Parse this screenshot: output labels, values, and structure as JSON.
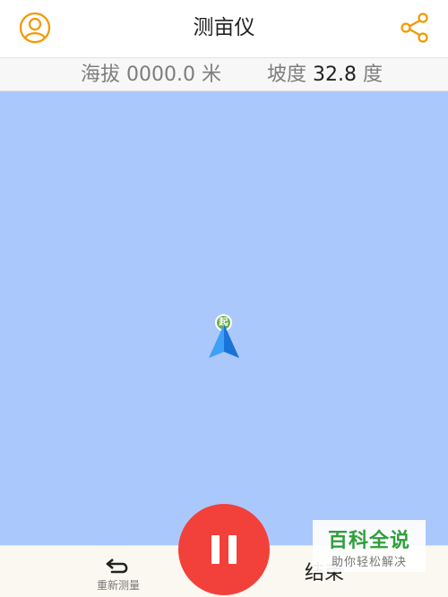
{
  "header": {
    "title": "测亩仪",
    "user_icon": "user-circle-icon",
    "share_icon": "share-icon",
    "accent_color": "#f39800"
  },
  "info_bar": {
    "altitude_label": "海拔",
    "altitude_value": "0000.0",
    "altitude_unit": "米",
    "slope_label": "坡度",
    "slope_value": "32.8",
    "slope_unit": "度"
  },
  "map": {
    "background_color": "#abc8fc",
    "start_marker_text": "起",
    "location_icon": "navigation-arrow-icon"
  },
  "bottom": {
    "remeasure_label": "重新测量",
    "remeasure_icon": "undo-arrow-icon",
    "finish_label": "结束",
    "pause_icon": "pause-icon",
    "pause_color": "#f2413a"
  },
  "watermark": {
    "main": "百科全说",
    "sub": "助你轻松解决"
  }
}
